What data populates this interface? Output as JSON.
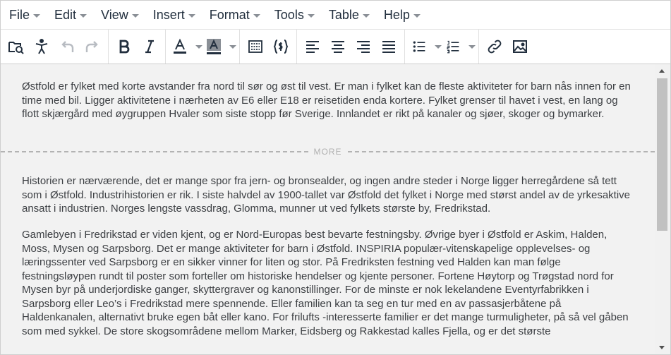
{
  "menubar": {
    "items": [
      {
        "label": "File"
      },
      {
        "label": "Edit"
      },
      {
        "label": "View"
      },
      {
        "label": "Insert"
      },
      {
        "label": "Format"
      },
      {
        "label": "Tools"
      },
      {
        "label": "Table"
      },
      {
        "label": "Help"
      }
    ]
  },
  "toolbar": {
    "icons": [
      "browse-image-icon",
      "accessibility-icon",
      "undo-icon",
      "redo-icon",
      "bold-icon",
      "italic-icon",
      "text-color-icon",
      "highlight-color-icon",
      "template-icon",
      "code-sample-icon",
      "align-left-icon",
      "align-center-icon",
      "align-right-icon",
      "align-justify-icon",
      "bullet-list-icon",
      "numbered-list-icon",
      "link-icon",
      "image-icon"
    ],
    "accent_color": "#222f3e"
  },
  "content": {
    "paragraph1": "Østfold er fylket med korte avstander fra nord til sør og øst til vest. Er man i fylket kan de fleste aktiviteter for barn nås innen for en time med bil. Ligger aktivitetene i nærheten av E6 eller E18 er reisetiden enda kortere. Fylket grenser til havet i vest, en lang og flott skjærgård med øygruppen Hvaler som siste stopp før Sverige. Innlandet er rikt på kanaler og sjøer, skoger og bymarker.",
    "more_label": "MORE",
    "paragraph2": "Historien er nærværende, det er mange spor fra jern- og bronsealder, og ingen andre steder i Norge ligger herregårdene så tett som i Østfold. Industrihistorien er rik. I siste halvdel av 1900-tallet var Østfold det fylket i Norge med størst andel av de yrkesaktive ansatt i industrien. Norges lengste vassdrag, Glomma, munner ut ved fylkets største by, Fredrikstad.",
    "paragraph3": "Gamlebyen i Fredrikstad er viden kjent, og er Nord-Europas best bevarte festningsby. Øvrige byer i Østfold er Askim, Halden, Moss, Mysen og Sarpsborg. Det er mange aktiviteter for barn i Østfold. INSPIRIA populær-vitenskapelige opplevelses- og læringssenter ved Sarpsborg er en sikker vinner for liten og stor. På Fredriksten festning ved Halden kan man følge festningsløypen rundt til poster som forteller om historiske hendelser og kjente personer. Fortene Høytorp og Trøgstad nord for Mysen byr på underjordiske ganger, skyttergraver og kanonstillinger.  For de minste er nok lekelandene Eventyrfabrikken i Sarpsborg eller Leo’s i Fredrikstad mere spennende. Eller familien kan ta seg en tur med en av passasjerbåtene på Haldenkanalen, alternativt bruke egen båt eller kano. For frilufts -interesserte familier er det mange turmuligheter, på så vel gåben som med sykkel. De store skogsområdene mellom Marker, Eidsberg og Rakkestad kalles Fjella, og er det største"
  }
}
